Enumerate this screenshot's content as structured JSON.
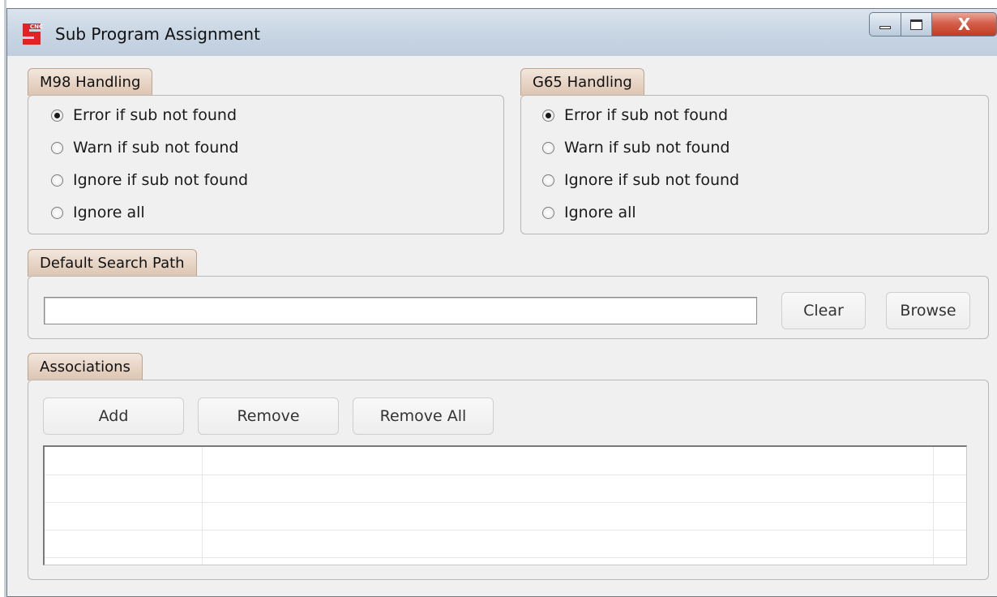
{
  "window": {
    "title": "Sub Program Assignment",
    "icon_text": "CNC",
    "close_glyph": "X"
  },
  "m98": {
    "title": "M98 Handling",
    "options": [
      {
        "label": "Error if sub not found",
        "checked": true
      },
      {
        "label": "Warn if sub not found",
        "checked": false
      },
      {
        "label": "Ignore if sub not found",
        "checked": false
      },
      {
        "label": "Ignore all",
        "checked": false
      }
    ]
  },
  "g65": {
    "title": "G65 Handling",
    "options": [
      {
        "label": "Error if sub not found",
        "checked": true
      },
      {
        "label": "Warn if sub not found",
        "checked": false
      },
      {
        "label": "Ignore if sub not found",
        "checked": false
      },
      {
        "label": "Ignore all",
        "checked": false
      }
    ]
  },
  "search_path": {
    "title": "Default Search Path",
    "value": "",
    "clear_label": "Clear",
    "browse_label": "Browse"
  },
  "associations": {
    "title": "Associations",
    "add_label": "Add",
    "remove_label": "Remove",
    "remove_all_label": "Remove All",
    "rows": []
  }
}
